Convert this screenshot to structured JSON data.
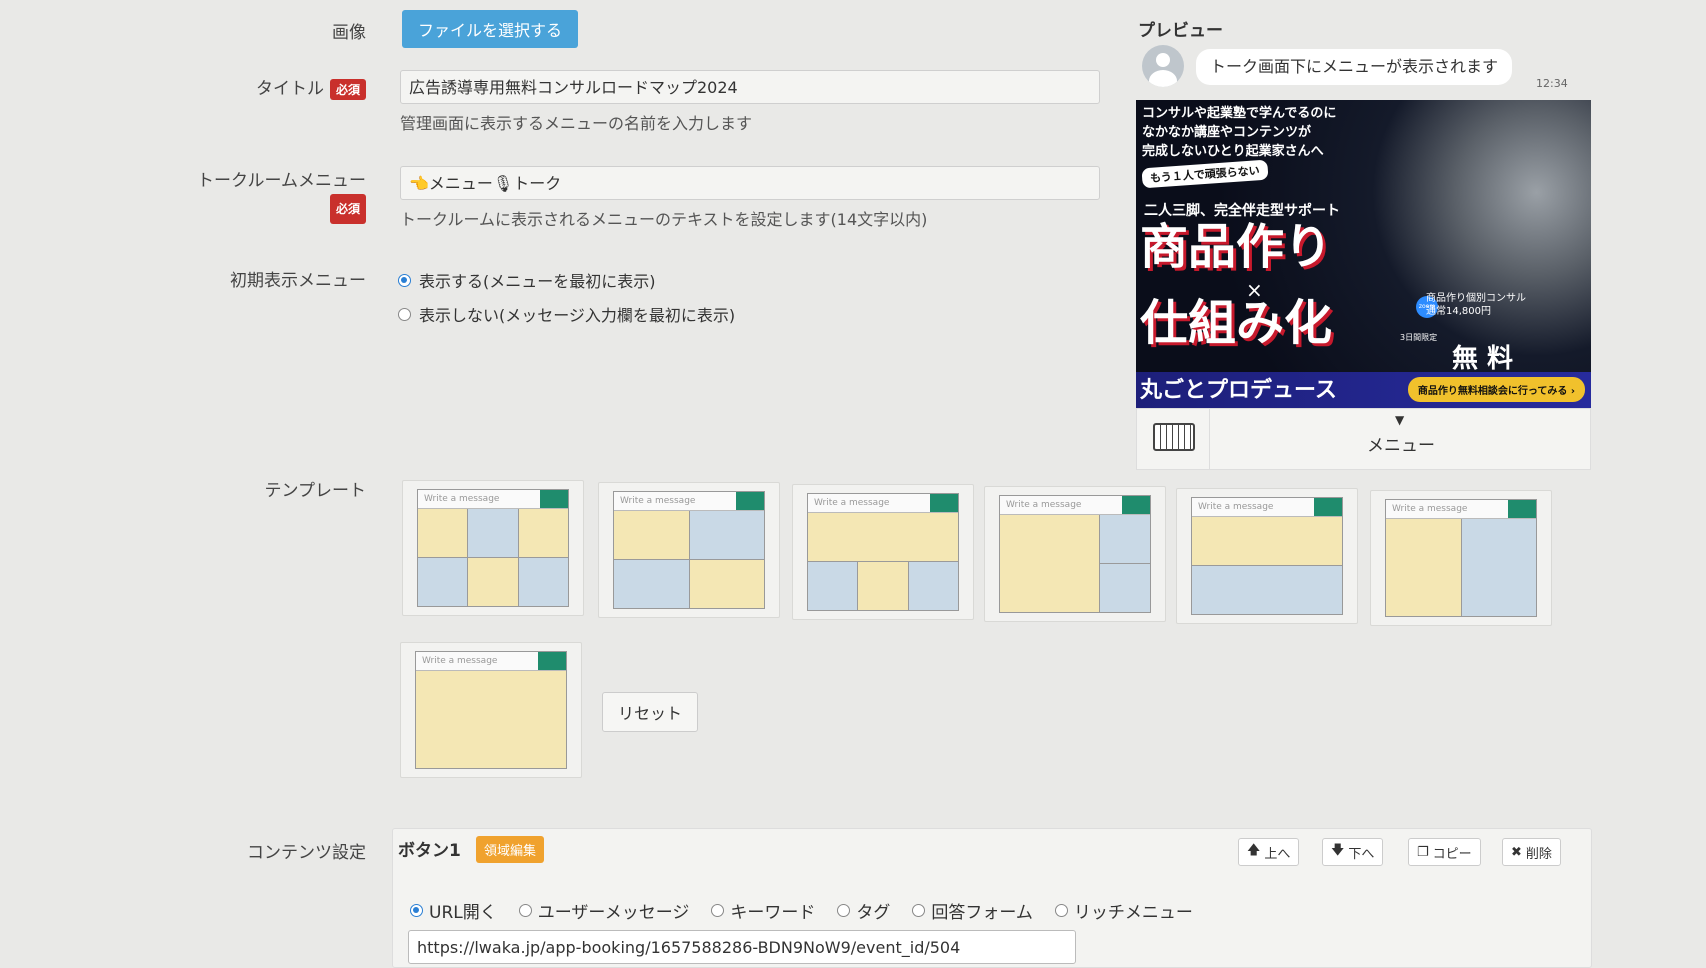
{
  "form": {
    "image_label": "画像",
    "file_button": "ファイルを選択する",
    "title_label": "タイトル",
    "required": "必須",
    "title_value": "広告誘導専用無料コンサルロードマップ2024",
    "title_help": "管理画面に表示するメニューの名前を入力します",
    "talkroom_label": "トークルームメニュー",
    "talkroom_value": "👈メニュー🎙トーク",
    "talkroom_help": "トークルームに表示されるメニューのテキストを設定します(14文字以内)",
    "initial_label": "初期表示メニュー",
    "initial_options": [
      "表示する(メニューを最初に表示)",
      "表示しない(メッセージ入力欄を最初に表示)"
    ],
    "initial_selected": 0,
    "template_label": "テンプレート",
    "template_bar_text": "Write a message",
    "reset": "リセット",
    "content_label": "コンテンツ設定"
  },
  "preview": {
    "title": "プレビュー",
    "message": "トーク画面下にメニューが表示されます",
    "time": "12:34",
    "menu_label": "メニュー",
    "banner": {
      "line1": "コンサルや起業塾で学んでるのに",
      "line2": "なかなか講座やコンテンツが",
      "line3": "完成しないひとり起業家さんへ",
      "pill": "もう１人で頑張らない",
      "sub": "二人三脚、完全伴走型サポート",
      "big1": "商品作り",
      "x": "×",
      "big2": "仕組み化",
      "zoom": "zoom",
      "consult1": "商品作り個別コンサル",
      "consult2": "通常14,800円",
      "limit": "3日間限定",
      "free": "無 料",
      "produce": "丸ごとプロデュース",
      "cta": "商品作り無料相談会に行ってみる ›"
    }
  },
  "content": {
    "button_title": "ボタン1",
    "area_edit": "領域編集",
    "up": "上へ",
    "down": "下へ",
    "copy": "コピー",
    "delete": "削除",
    "types": [
      "URL開く",
      "ユーザーメッセージ",
      "キーワード",
      "タグ",
      "回答フォーム",
      "リッチメニュー"
    ],
    "type_selected": 0,
    "url": "https://lwaka.jp/app-booking/1657588286-BDN9NoW9/event_id/504"
  }
}
